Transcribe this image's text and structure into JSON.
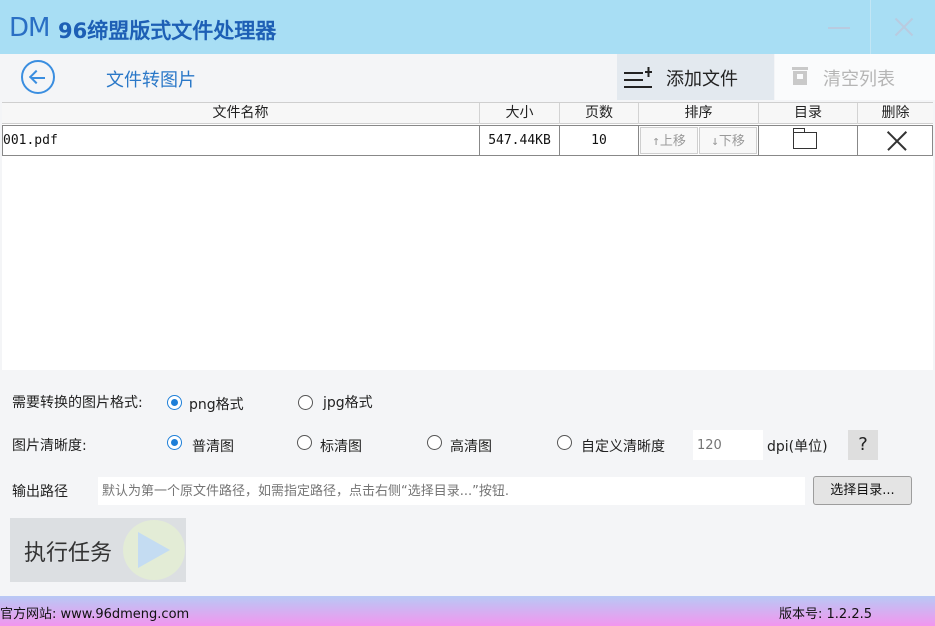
{
  "app": {
    "logo": "DM",
    "title": "96缔盟版式文件处理器"
  },
  "toolbar": {
    "page_title": "文件转图片",
    "add_label": "添加文件",
    "clear_label": "清空列表"
  },
  "table": {
    "headers": [
      "文件名称",
      "大小",
      "页数",
      "排序",
      "目录",
      "删除"
    ],
    "rows": [
      {
        "name": "001.pdf",
        "size": "547.44KB",
        "pages": "10",
        "up_label": "↑上移",
        "down_label": "↓下移"
      }
    ]
  },
  "options": {
    "format_label": "需要转换的图片格式:",
    "format_options": [
      "png格式",
      "jpg格式"
    ],
    "format_selected": "png格式",
    "clarity_label": "图片清晰度:",
    "clarity_options": [
      "普清图",
      "标清图",
      "高清图",
      "自定义清晰度"
    ],
    "clarity_selected": "普清图",
    "dpi_placeholder": "120",
    "dpi_unit": "dpi(单位)",
    "help_label": "?",
    "output_label": "输出路径",
    "output_placeholder": "默认为第一个原文件路径，如需指定路径，点击右侧“选择目录...”按钮.",
    "browse_label": "选择目录..."
  },
  "run": {
    "label": "执行任务"
  },
  "footer": {
    "site": "官方网站:  www.96dmeng.com",
    "version": "版本号: 1.2.2.5"
  },
  "colors": {
    "titlebar": "#a8def4",
    "accent": "#1e7fd8",
    "footer_top": "#b8c9f5",
    "footer_bottom": "#f296ee"
  }
}
